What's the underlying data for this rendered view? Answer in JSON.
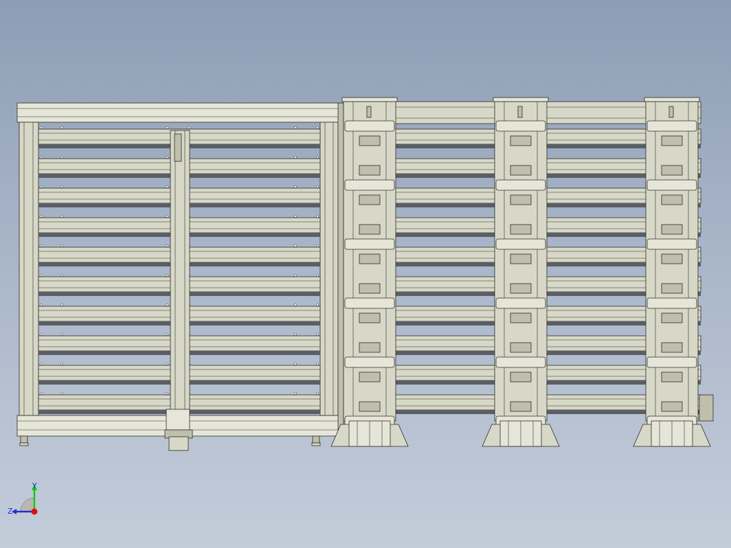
{
  "viewport": {
    "background_top": "#8e9db4",
    "background_bottom": "#c3ccd9"
  },
  "model": {
    "colors": {
      "metal": "#d8d8c8",
      "metal_dark": "#bfbfae",
      "metal_light": "#e6e6d8",
      "edge": "#2b2b24",
      "gap": "#5a5e66"
    },
    "shelf_count": 10,
    "towers": 3,
    "tower_bracket_levels": 6
  },
  "triad": {
    "x_label": "X",
    "y_label": "Y",
    "z_label": "Z",
    "y_color": "#14c814",
    "z_color": "#1f2fd0",
    "origin_color": "#e01010"
  }
}
